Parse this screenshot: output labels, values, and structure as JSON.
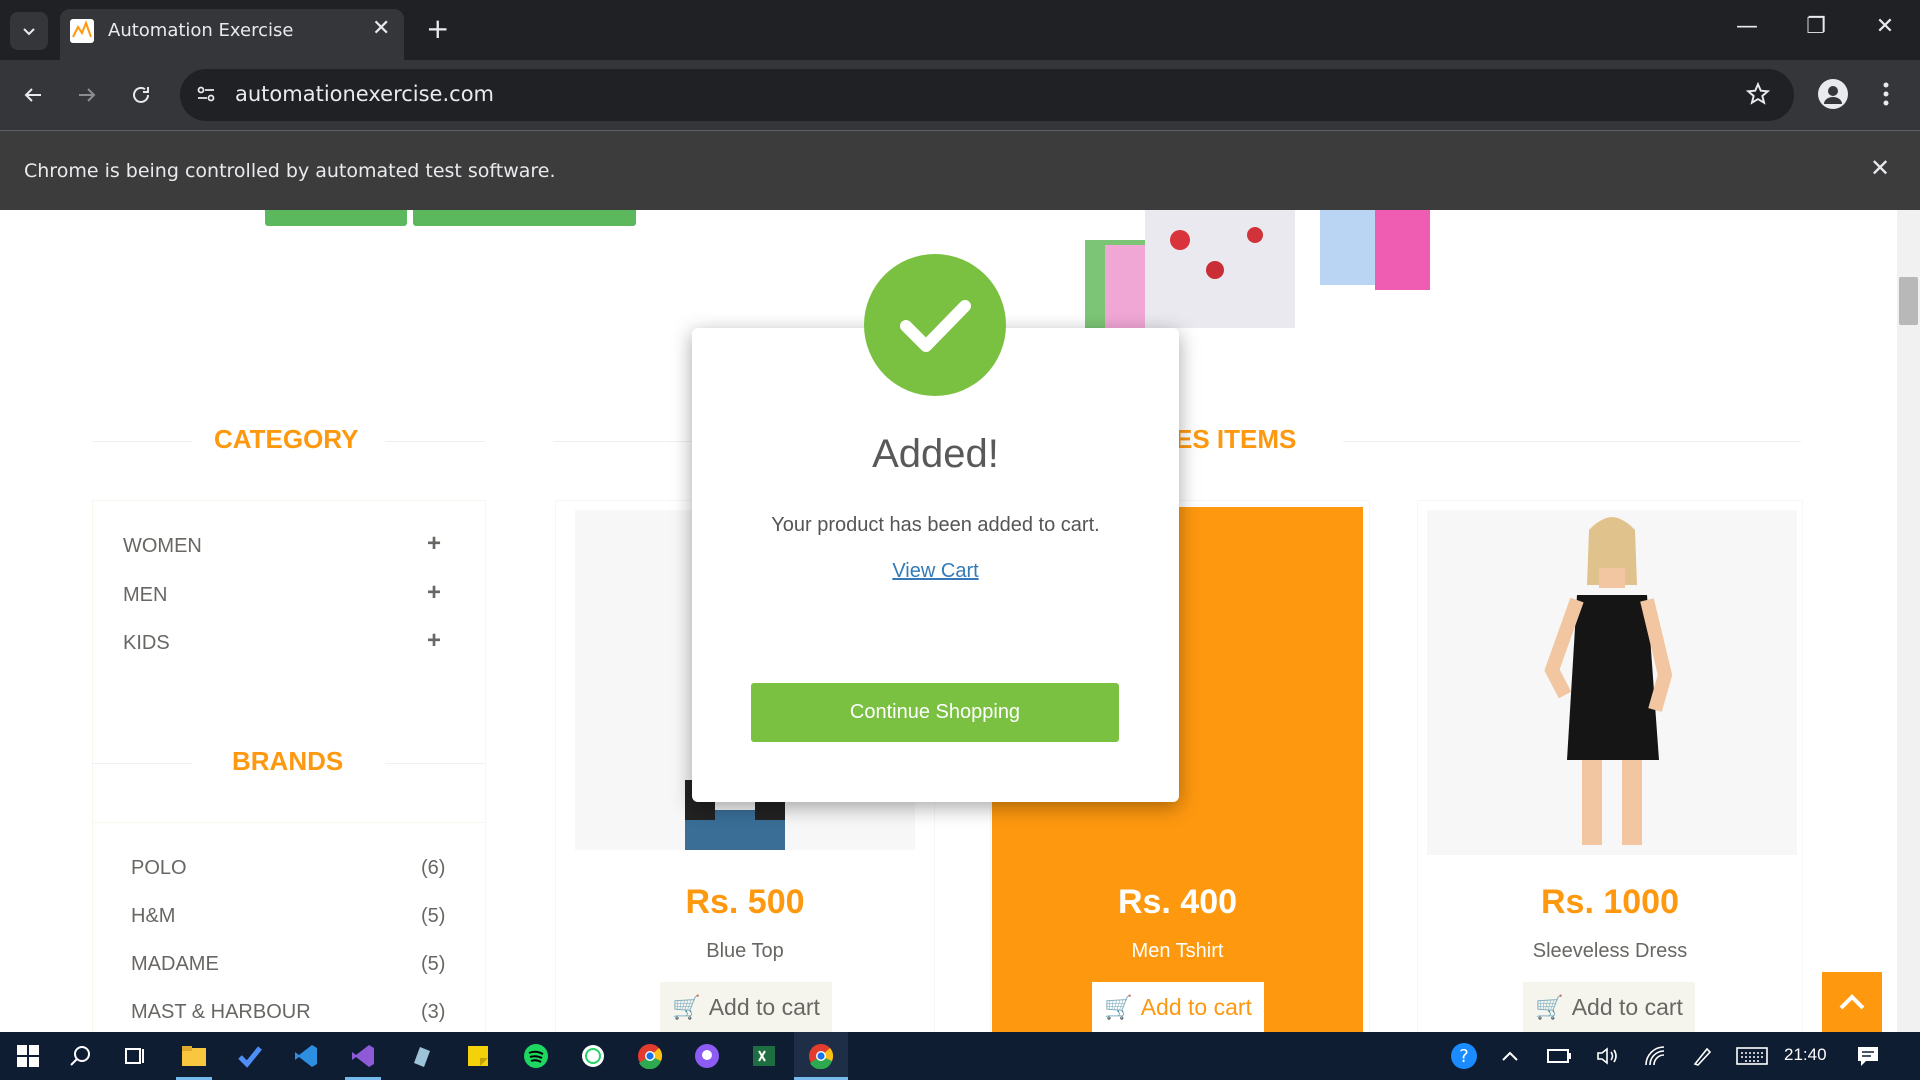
{
  "browser": {
    "tab_title": "Automation Exercise",
    "tab_close": "✕",
    "new_tab": "+",
    "url": "automationexercise.com",
    "infobar_text": "Chrome is being controlled by automated test software.",
    "window_controls": {
      "minimize": "—",
      "restore": "❐",
      "close": "✕"
    }
  },
  "sidebar": {
    "category_title": "CATEGORY",
    "categories": [
      {
        "label": "WOMEN",
        "toggle": "+"
      },
      {
        "label": "MEN",
        "toggle": "+"
      },
      {
        "label": "KIDS",
        "toggle": "+"
      }
    ],
    "brands_title": "BRANDS",
    "brands": [
      {
        "label": "POLO",
        "count": "(6)"
      },
      {
        "label": "H&M",
        "count": "(5)"
      },
      {
        "label": "MADAME",
        "count": "(5)"
      },
      {
        "label": "MAST & HARBOUR",
        "count": "(3)"
      }
    ]
  },
  "features": {
    "title_fragment": "ES ITEMS",
    "products": [
      {
        "price": "Rs. 500",
        "name": "Blue Top",
        "button": "Add to cart"
      },
      {
        "price": "Rs. 400",
        "name": "Men Tshirt",
        "button": "Add to cart"
      },
      {
        "price": "Rs. 1000",
        "name": "Sleeveless Dress",
        "button": "Add to cart"
      }
    ]
  },
  "modal": {
    "title": "Added!",
    "message": "Your product has been added to cart.",
    "view_cart": "View Cart",
    "continue": "Continue Shopping"
  },
  "taskbar": {
    "clock": "21:40"
  },
  "colors": {
    "accent_orange": "#fe980f",
    "success_green": "#7ac142",
    "link_blue": "#337ab7"
  }
}
